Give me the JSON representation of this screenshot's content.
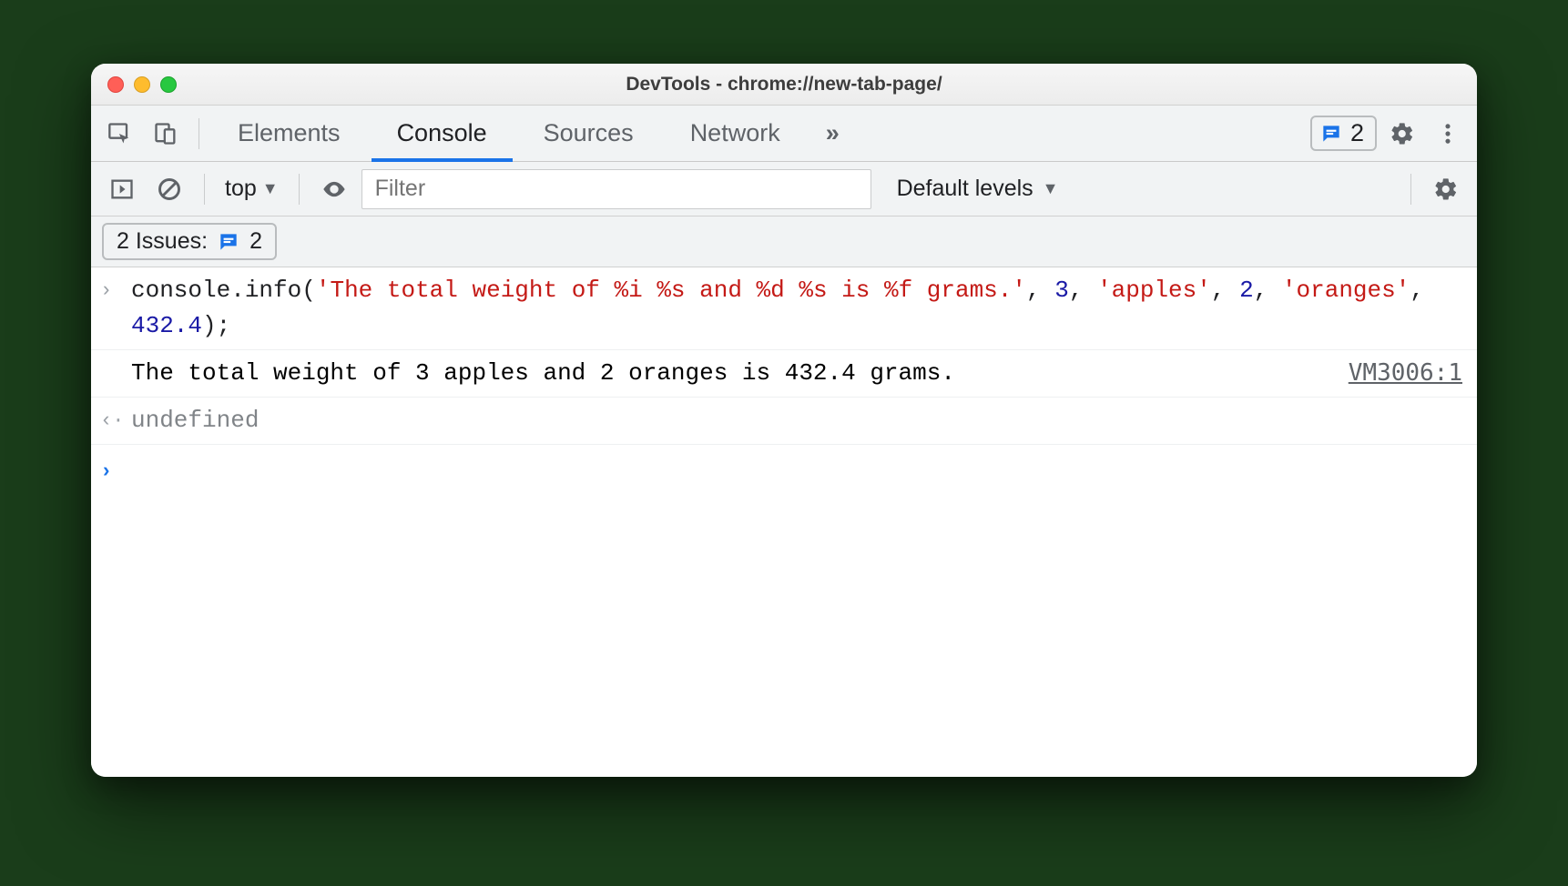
{
  "window": {
    "title": "DevTools - chrome://new-tab-page/"
  },
  "tabs": {
    "elements": "Elements",
    "console": "Console",
    "sources": "Sources",
    "network": "Network"
  },
  "issues_badge": "2",
  "console_toolbar": {
    "context": "top",
    "filter_placeholder": "Filter",
    "levels": "Default levels"
  },
  "issues_row": {
    "label": "2 Issues:",
    "count": "2"
  },
  "log": {
    "input_code": {
      "seg1": "console",
      "dot1": ".",
      "seg2": "info",
      "open": "(",
      "str1": "'The total weight of %i %s and %d %s is %f grams.'",
      "c1": ", ",
      "n1": "3",
      "c2": ", ",
      "str2": "'apples'",
      "c3": ", ",
      "n2": "2",
      "c4": ", ",
      "str3": "'oranges'",
      "c5": ", ",
      "n3": "432.4",
      "close": ");"
    },
    "output_text": "The total weight of 3 apples and 2 oranges is 432.4 grams.",
    "source_link": "VM3006:1",
    "return_value": "undefined"
  },
  "glyphs": {
    "input_arrow": "›",
    "return_arrow": "‹·",
    "prompt_arrow": "›",
    "more": "»",
    "triangle": "▼"
  }
}
